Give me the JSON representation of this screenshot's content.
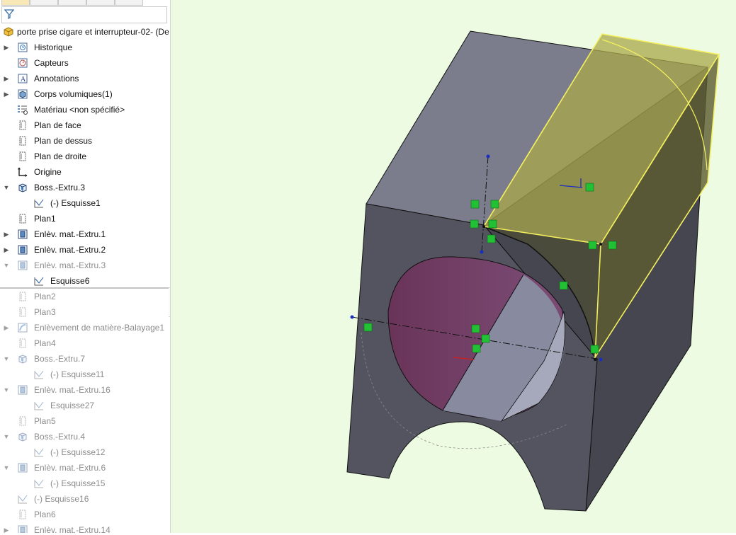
{
  "filter": {
    "icon": "filter-icon"
  },
  "root": {
    "label": "porte prise cigare et interrupteur-02-  (De",
    "icon": "part-icon"
  },
  "tree": [
    {
      "label": "Historique",
      "icon": "history-icon",
      "arrow": "▶",
      "dim": false
    },
    {
      "label": "Capteurs",
      "icon": "sensor-icon",
      "arrow": "",
      "dim": false
    },
    {
      "label": "Annotations",
      "icon": "annotation-icon",
      "arrow": "▶",
      "dim": false
    },
    {
      "label": "Corps volumiques(1)",
      "icon": "solid-bodies-icon",
      "arrow": "▶",
      "dim": false
    },
    {
      "label": "Matériau <non spécifié>",
      "icon": "material-icon",
      "arrow": "",
      "dim": false
    },
    {
      "label": "Plan de face",
      "icon": "plane-icon",
      "arrow": "",
      "dim": false
    },
    {
      "label": "Plan de dessus",
      "icon": "plane-icon",
      "arrow": "",
      "dim": false
    },
    {
      "label": "Plan de droite",
      "icon": "plane-icon",
      "arrow": "",
      "dim": false
    },
    {
      "label": "Origine",
      "icon": "origin-icon",
      "arrow": "",
      "dim": false
    },
    {
      "label": "Boss.-Extru.3",
      "icon": "boss-extrude-icon",
      "arrow": "▼",
      "dim": false
    },
    {
      "label": "(-) Esquisse1",
      "icon": "sketch-icon",
      "arrow": "",
      "dim": false,
      "indent": 1
    },
    {
      "label": "Plan1",
      "icon": "plane-icon",
      "arrow": "",
      "dim": false
    },
    {
      "label": "Enlèv. mat.-Extru.1",
      "icon": "cut-extrude-icon",
      "arrow": "▶",
      "dim": false
    },
    {
      "label": "Enlèv. mat.-Extru.2",
      "icon": "cut-extrude-icon",
      "arrow": "▶",
      "dim": false
    },
    {
      "label": "Enlèv. mat.-Extru.3",
      "icon": "cut-extrude-icon",
      "arrow": "▼",
      "dim": true
    },
    {
      "label": "Esquisse6",
      "icon": "sketch-icon",
      "arrow": "",
      "dim": false,
      "indent": 1
    },
    {
      "label": "Plan2",
      "icon": "plane-icon",
      "arrow": "",
      "dim": true
    },
    {
      "label": "Plan3",
      "icon": "plane-icon",
      "arrow": "",
      "dim": true
    },
    {
      "label": "Enlèvement de matière-Balayage1",
      "icon": "sweep-cut-icon",
      "arrow": "▶",
      "dim": true
    },
    {
      "label": "Plan4",
      "icon": "plane-icon",
      "arrow": "",
      "dim": true
    },
    {
      "label": "Boss.-Extru.7",
      "icon": "boss-extrude-icon",
      "arrow": "▼",
      "dim": true
    },
    {
      "label": "(-) Esquisse11",
      "icon": "sketch-icon",
      "arrow": "",
      "dim": true,
      "indent": 1
    },
    {
      "label": "Enlèv. mat.-Extru.16",
      "icon": "cut-extrude-icon",
      "arrow": "▼",
      "dim": true
    },
    {
      "label": "Esquisse27",
      "icon": "sketch-icon",
      "arrow": "",
      "dim": true,
      "indent": 1
    },
    {
      "label": "Plan5",
      "icon": "plane-icon",
      "arrow": "",
      "dim": true
    },
    {
      "label": "Boss.-Extru.4",
      "icon": "boss-extrude-icon",
      "arrow": "▼",
      "dim": true
    },
    {
      "label": "(-) Esquisse12",
      "icon": "sketch-icon",
      "arrow": "",
      "dim": true,
      "indent": 1
    },
    {
      "label": "Enlèv. mat.-Extru.6",
      "icon": "cut-extrude-icon",
      "arrow": "▼",
      "dim": true
    },
    {
      "label": "(-) Esquisse15",
      "icon": "sketch-icon",
      "arrow": "",
      "dim": true,
      "indent": 1
    },
    {
      "label": "(-) Esquisse16",
      "icon": "sketch-icon",
      "arrow": "",
      "dim": true
    },
    {
      "label": "Plan6",
      "icon": "plane-icon",
      "arrow": "",
      "dim": true
    },
    {
      "label": "Enlèv. mat.-Extru.14",
      "icon": "cut-extrude-icon",
      "arrow": "▶",
      "dim": true
    }
  ],
  "colors": {
    "viewport_bg": "#ecfbe2",
    "body_face_front": "#52535f",
    "body_face_top": "#7b7d8d",
    "body_face_right": "#44454f",
    "selection_yellow": "#f4f060",
    "hole_magenta": "#6e3a62",
    "relation_green": "#22c034"
  }
}
